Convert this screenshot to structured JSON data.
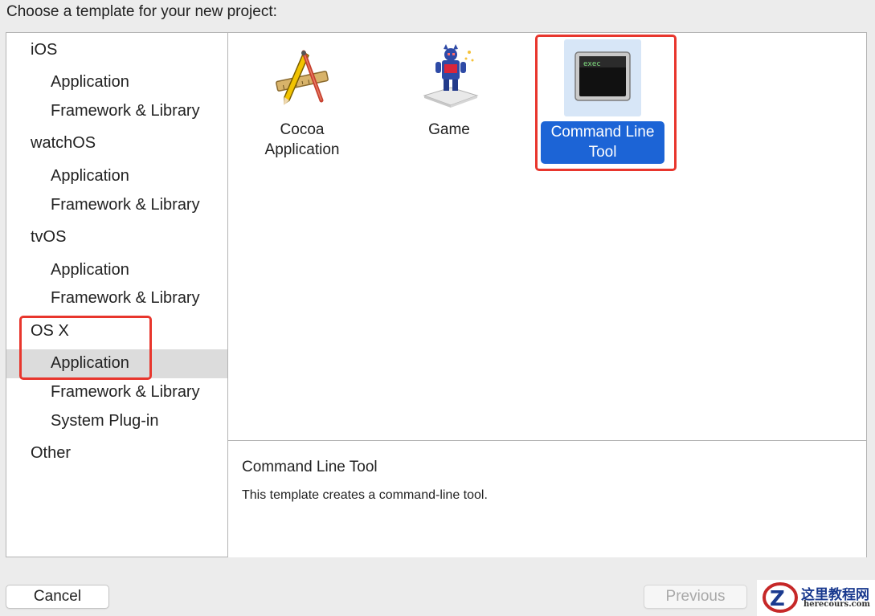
{
  "prompt": "Choose a template for your new project:",
  "sidebar": {
    "items": [
      {
        "kind": "category",
        "label": "iOS"
      },
      {
        "kind": "sub",
        "label": "Application"
      },
      {
        "kind": "sub",
        "label": "Framework & Library"
      },
      {
        "kind": "category",
        "label": "watchOS"
      },
      {
        "kind": "sub",
        "label": "Application"
      },
      {
        "kind": "sub",
        "label": "Framework & Library"
      },
      {
        "kind": "category",
        "label": "tvOS"
      },
      {
        "kind": "sub",
        "label": "Application"
      },
      {
        "kind": "sub",
        "label": "Framework & Library"
      },
      {
        "kind": "category",
        "label": "OS X"
      },
      {
        "kind": "sub",
        "label": "Application",
        "selected": true
      },
      {
        "kind": "sub",
        "label": "Framework & Library"
      },
      {
        "kind": "sub",
        "label": "System Plug-in"
      },
      {
        "kind": "category",
        "label": "Other"
      }
    ]
  },
  "templates": [
    {
      "label": "Cocoa\nApplication",
      "icon": "cocoa-app-icon"
    },
    {
      "label": "Game",
      "icon": "game-icon"
    },
    {
      "label": "Command Line\nTool",
      "icon": "terminal-icon",
      "selected": true,
      "icon_text": "exec"
    }
  ],
  "description": {
    "title": "Command Line Tool",
    "text": "This template creates a command-line tool."
  },
  "buttons": {
    "cancel": "Cancel",
    "previous": "Previous"
  },
  "watermark": {
    "title": "这里教程网",
    "url": "herecours.com"
  },
  "colors": {
    "selection": "#1c64d6",
    "highlight_box": "#e8362d",
    "sidebar_selected_row": "#dcdcdc"
  }
}
